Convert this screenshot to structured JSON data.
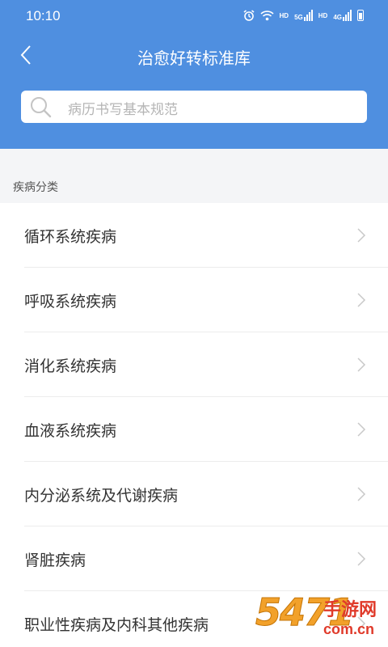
{
  "status_bar": {
    "time": "10:10",
    "hd_1": "HD",
    "hd_2": "HD",
    "network_1": "5G",
    "network_2": "4G"
  },
  "header": {
    "title": "治愈好转标准库",
    "background_color": "#4f8fe0"
  },
  "search": {
    "placeholder": "病历书写基本规范"
  },
  "section": {
    "label": "疾病分类"
  },
  "categories": [
    {
      "label": "循环系统疾病"
    },
    {
      "label": "呼吸系统疾病"
    },
    {
      "label": "消化系统疾病"
    },
    {
      "label": "血液系统疾病"
    },
    {
      "label": "内分泌系统及代谢疾病"
    },
    {
      "label": "肾脏疾病"
    },
    {
      "label": "职业性疾病及内科其他疾病"
    }
  ],
  "watermark": {
    "number": "5471",
    "brand": "手游网",
    "url": "com.cn"
  },
  "icons": {
    "back": "chevron-left-icon",
    "search": "search-icon",
    "row_arrow": "chevron-right-icon"
  }
}
